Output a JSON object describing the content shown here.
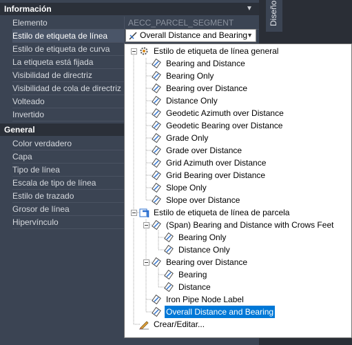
{
  "palette": {
    "section_info": "Información",
    "section_general": "General",
    "info_rows": [
      {
        "label": "Elemento",
        "value": "AECC_PARCEL_SEGMENT"
      },
      {
        "label": "Estilo de etiqueta de línea",
        "value": "Overall Distance and Bearing"
      },
      {
        "label": "Estilo de etiqueta de curva",
        "value": ""
      },
      {
        "label": "La etiqueta está fijada",
        "value": ""
      },
      {
        "label": "Visibilidad de directriz",
        "value": ""
      },
      {
        "label": "Visibilidad de cola de directriz",
        "value": ""
      },
      {
        "label": "Volteado",
        "value": ""
      },
      {
        "label": "Invertido",
        "value": ""
      }
    ],
    "general_rows": [
      {
        "label": "Color verdadero"
      },
      {
        "label": "Capa"
      },
      {
        "label": "Tipo de línea"
      },
      {
        "label": "Escala de tipo de línea"
      },
      {
        "label": "Estilo de trazado"
      },
      {
        "label": "Grosor de línea"
      },
      {
        "label": "Hipervínculo"
      }
    ],
    "side_tab": "Diseño"
  },
  "dropdown": {
    "group_general": "Estilo de etiqueta de línea general",
    "general_items": [
      "Bearing and Distance",
      "Bearing Only",
      "Bearing over Distance",
      "Distance Only",
      "Geodetic Azimuth over Distance",
      "Geodetic Bearing over Distance",
      "Grade Only",
      "Grade over Distance",
      "Grid Azimuth over Distance",
      "Grid Bearing over Distance",
      "Slope Only",
      "Slope over Distance"
    ],
    "group_parcel": "Estilo de etiqueta de línea de parcela",
    "span_group": "(Span)  Bearing and Distance with Crows Feet",
    "span_children": [
      "Bearing Only",
      "Distance Only"
    ],
    "bod_group": "Bearing over Distance",
    "bod_children": [
      "Bearing",
      "Distance"
    ],
    "iron_pipe": "Iron Pipe Node Label",
    "selected_item": "Overall Distance and Bearing",
    "create_edit": "Crear/Editar..."
  },
  "colors": {
    "panel_bg": "#3b4453",
    "header_bg": "#2b3039",
    "selection": "#0078d7"
  }
}
